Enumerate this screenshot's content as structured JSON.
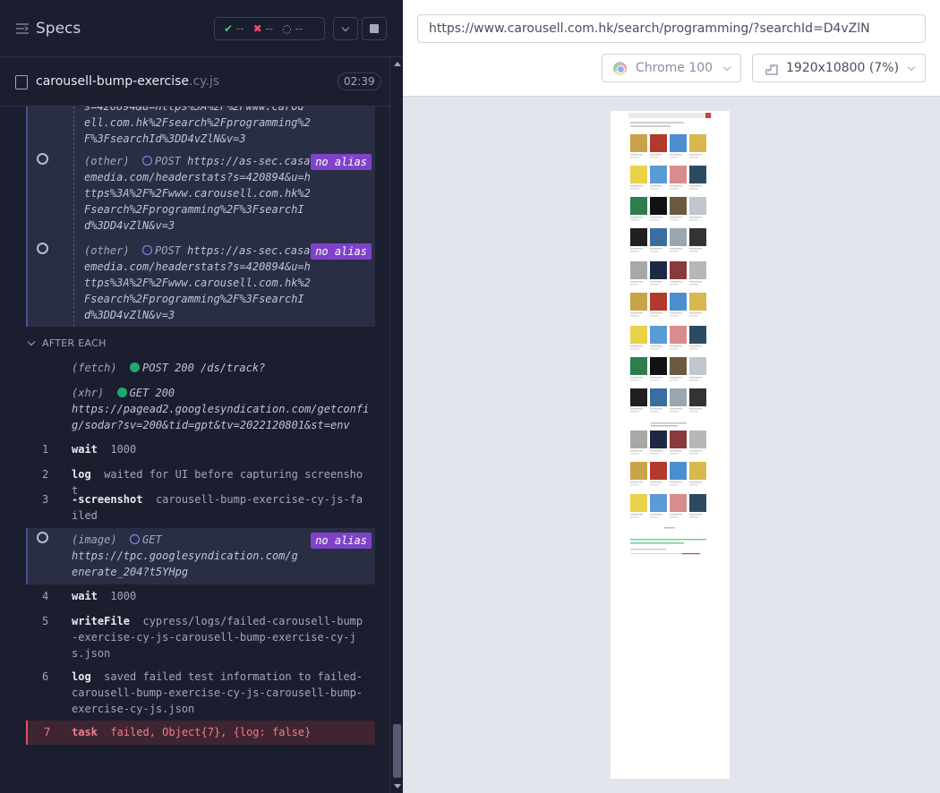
{
  "sidebar": {
    "title": "Specs",
    "stats": {
      "passed": "--",
      "failed": "--",
      "pending": "--"
    }
  },
  "spec": {
    "name": "carousell-bump-exercise",
    "ext": ".cy.js",
    "duration": "02:39"
  },
  "hook_entries": [
    {
      "partial_url_line": "ell.com.hk%2Fsearch%2Fprogramming%2F%3FsearchId%3DD4vZlN&v=3"
    },
    {
      "type": "(other)",
      "method": "POST",
      "url": "https://as-sec.casalemedia.com/headerstats?s=420894&u=https%3A%2F%2Fwww.carousell.com.hk%2Fsearch%2Fprogramming%2F%3FsearchId%3DD4vZlN&v=3",
      "badge": "no alias"
    },
    {
      "type": "(other)",
      "method": "POST",
      "url": "https://as-sec.casalemedia.com/headerstats?s=420894&u=https%3A%2F%2Fwww.carousell.com.hk%2Fsearch%2Fprogramming%2F%3FsearchId%3DD4vZlN&v=3",
      "badge": "no alias"
    }
  ],
  "after_each": {
    "label": "AFTER EACH",
    "fetch": {
      "type": "(fetch)",
      "text": "POST 200 /ds/track?"
    },
    "xhr": {
      "type": "(xhr)",
      "status": "GET 200",
      "url": "https://pagead2.googlesyndication.com/getconfig/sodar?sv=200&tid=gpt&tv=2022120801&st=env"
    },
    "commands": [
      {
        "num": "1",
        "name": "wait",
        "msg": "1000"
      },
      {
        "num": "2",
        "name": "log",
        "msg": "waited for UI before capturing screenshot"
      },
      {
        "num": "3",
        "name": "-screenshot",
        "msg": "carousell-bump-exercise-cy-js-failed"
      },
      {
        "num": "4",
        "name": "wait",
        "msg": "1000"
      },
      {
        "num": "5",
        "name": "writeFile",
        "msg": "cypress/logs/failed-carousell-bump-exercise-cy-js-carousell-bump-exercise-cy-js.json"
      },
      {
        "num": "6",
        "name": "log",
        "msg": "saved failed test information to failed-carousell-bump-exercise-cy-js-carousell-bump-exercise-cy-js.json"
      },
      {
        "num": "7",
        "name": "task",
        "msg": "failed, Object{7}, {log: false}"
      }
    ],
    "image": {
      "type": "(image)",
      "method": "GET",
      "url": "https://tpc.googlesyndication.com/generate_204?t5YHpg",
      "badge": "no alias"
    }
  },
  "browser": {
    "url": "https://www.carousell.com.hk/search/programming/?searchId=D4vZlN",
    "name": "Chrome 100",
    "viewport": "1920x10800 (7%)"
  },
  "colors": {
    "accent": "#7f43c9",
    "failed": "#e05263",
    "passed": "#1fa971"
  }
}
